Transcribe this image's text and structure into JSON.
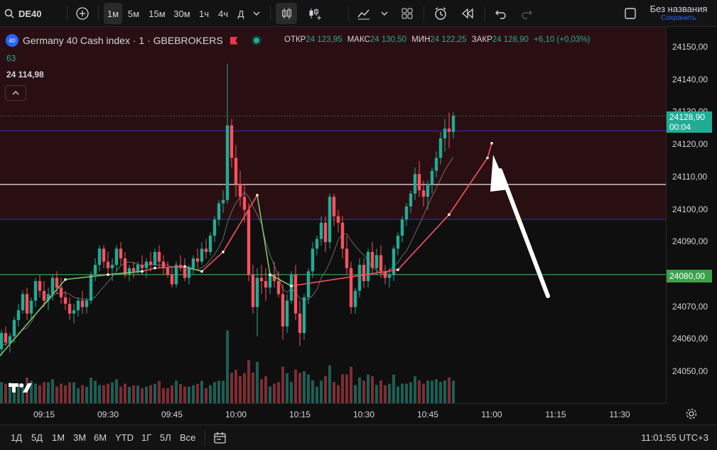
{
  "toolbar": {
    "symbol": "DE40",
    "intervals": [
      "1м",
      "5м",
      "15м",
      "30м",
      "1ч",
      "4ч",
      "Д"
    ],
    "selected_interval": "1м",
    "layout_title": "Без названия",
    "layout_status": "Сохранить"
  },
  "legend": {
    "title": "Germany 40 Cash index · 1 · GBEBROKERS",
    "open_label": "ОТКР",
    "open": "24 123,95",
    "high_label": "МАКС",
    "high": "24 130,50",
    "low_label": "МИН",
    "low": "24 122,25",
    "close_label": "ЗАКР",
    "close": "24 128,90",
    "change": "+6,10 (+0,03%)",
    "indicator_value": "63",
    "indicator_price": "24 114,98"
  },
  "price_axis": {
    "ticks": [
      "24150,00",
      "24140,00",
      "24130,00",
      "24120,00",
      "24110,00",
      "24100,00",
      "24090,00",
      "24080,00",
      "24070,00",
      "24060,00",
      "24050,00"
    ],
    "current_price": "24128,90",
    "countdown": "00:04",
    "level_label": "24080,00"
  },
  "time_axis": {
    "ticks": [
      "09:15",
      "09:30",
      "09:45",
      "10:00",
      "10:15",
      "10:30",
      "10:45",
      "11:00",
      "11:15",
      "11:30"
    ]
  },
  "bottom": {
    "ranges": [
      "1Д",
      "5Д",
      "1М",
      "3М",
      "6М",
      "YTD",
      "1Г",
      "5Л",
      "Все"
    ],
    "clock": "11:01:55 UTC+3"
  },
  "colors": {
    "up": "#22ab94",
    "down": "#f7525f",
    "background": "#0f0f0f",
    "zone": "#2a0f12",
    "blue_line": "#2929c8",
    "green_line": "#3aa14b",
    "white_line": "#e8e8e8"
  },
  "chart_data": {
    "type": "candlestick",
    "symbol": "DE40",
    "interval": "1m",
    "ylim": [
      24043,
      24157
    ],
    "x_range": [
      "09:03",
      "11:39"
    ],
    "horizontal_levels": [
      {
        "price": 24124.3,
        "color": "blue"
      },
      {
        "price": 24107.8,
        "color": "white"
      },
      {
        "price": 24097.0,
        "color": "blue"
      },
      {
        "price": 24080.0,
        "color": "green"
      }
    ],
    "zone": {
      "from": 24097.0,
      "to": 24157.0
    },
    "last_price": 24128.9,
    "zigzag": [
      {
        "time": "09:04",
        "price": 24054,
        "dir": "up"
      },
      {
        "time": "09:20",
        "price": 24078.5,
        "dir": "up"
      },
      {
        "time": "09:30",
        "price": 24080,
        "dir": "up"
      },
      {
        "time": "09:38",
        "price": 24081,
        "dir": "up"
      },
      {
        "time": "09:41",
        "price": 24082,
        "dir": "up"
      },
      {
        "time": "09:48",
        "price": 24082.5,
        "dir": "up"
      },
      {
        "time": "09:52",
        "price": 24081,
        "dir": "down"
      },
      {
        "time": "09:57",
        "price": 24087,
        "dir": "up"
      },
      {
        "time": "10:05",
        "price": 24104.5,
        "dir": "up"
      },
      {
        "time": "10:08",
        "price": 24080,
        "dir": "down"
      },
      {
        "time": "10:13",
        "price": 24076.5,
        "dir": "down"
      },
      {
        "time": "10:38",
        "price": 24081.5,
        "dir": "up"
      },
      {
        "time": "10:50",
        "price": 24098.5,
        "dir": "up"
      },
      {
        "time": "10:59",
        "price": 24116,
        "dir": "up"
      },
      {
        "time": "11:00",
        "price": 24120.5,
        "dir": "up"
      }
    ],
    "candles_note": "1-minute candles from 09:03 to 11:01; values estimated from the price axis",
    "candles": [
      [
        24054,
        24058,
        24052,
        24056
      ],
      [
        24056,
        24059,
        24054,
        24057
      ],
      [
        24057,
        24063,
        24055,
        24062
      ],
      [
        24062,
        24064,
        24058,
        24059
      ],
      [
        24059,
        24062,
        24056,
        24061
      ],
      [
        24061,
        24067,
        24059,
        24066
      ],
      [
        24066,
        24071,
        24064,
        24069
      ],
      [
        24069,
        24075,
        24068,
        24074
      ],
      [
        24074,
        24076,
        24066,
        24068
      ],
      [
        24068,
        24073,
        24066,
        24072
      ],
      [
        24072,
        24079,
        24070,
        24078
      ],
      [
        24078,
        24080,
        24073,
        24075
      ],
      [
        24075,
        24078,
        24070,
        24072
      ],
      [
        24072,
        24076,
        24069,
        24074
      ],
      [
        24074,
        24080,
        24072,
        24079
      ],
      [
        24079,
        24081,
        24074,
        24076
      ],
      [
        24076,
        24079,
        24071,
        24073
      ],
      [
        24073,
        24075,
        24069,
        24071
      ],
      [
        24071,
        24073,
        24066,
        24068
      ],
      [
        24068,
        24071,
        24065,
        24069
      ],
      [
        24069,
        24073,
        24067,
        24072
      ],
      [
        24072,
        24075,
        24068,
        24070
      ],
      [
        24070,
        24073,
        24068,
        24072
      ],
      [
        24072,
        24081,
        24071,
        24080
      ],
      [
        24080,
        24085,
        24078,
        24083
      ],
      [
        24083,
        24089,
        24081,
        24088
      ],
      [
        24088,
        24089,
        24082,
        24084
      ],
      [
        24084,
        24087,
        24080,
        24082
      ],
      [
        24082,
        24085,
        24078,
        24083
      ],
      [
        24083,
        24089,
        24081,
        24088
      ],
      [
        24088,
        24090,
        24083,
        24085
      ],
      [
        24085,
        24087,
        24079,
        24080
      ],
      [
        24080,
        24083,
        24078,
        24082
      ],
      [
        24082,
        24084,
        24079,
        24081
      ],
      [
        24081,
        24084,
        24080,
        24083
      ],
      [
        24083,
        24086,
        24080,
        24082
      ],
      [
        24082,
        24085,
        24079,
        24084
      ],
      [
        24084,
        24087,
        24081,
        24083
      ],
      [
        24083,
        24088,
        24082,
        24087
      ],
      [
        24087,
        24089,
        24082,
        24084
      ],
      [
        24084,
        24086,
        24080,
        24082
      ],
      [
        24082,
        24084,
        24079,
        24080
      ],
      [
        24080,
        24082,
        24076,
        24077
      ],
      [
        24077,
        24084,
        24076,
        24083
      ],
      [
        24083,
        24086,
        24081,
        24082
      ],
      [
        24082,
        24085,
        24078,
        24079
      ],
      [
        24079,
        24083,
        24077,
        24082
      ],
      [
        24082,
        24086,
        24080,
        24085
      ],
      [
        24085,
        24088,
        24082,
        24084
      ],
      [
        24084,
        24090,
        24083,
        24088
      ],
      [
        24088,
        24091,
        24085,
        24087
      ],
      [
        24087,
        24093,
        24086,
        24092
      ],
      [
        24092,
        24098,
        24090,
        24097
      ],
      [
        24097,
        24103,
        24095,
        24102
      ],
      [
        24102,
        24106,
        24099,
        24103
      ],
      [
        24103,
        24145,
        24102,
        24126
      ],
      [
        24126,
        24128,
        24113,
        24116
      ],
      [
        24116,
        24120,
        24104,
        24108
      ],
      [
        24108,
        24112,
        24101,
        24104
      ],
      [
        24104,
        24108,
        24096,
        24100
      ],
      [
        24100,
        24102,
        24078,
        24080
      ],
      [
        24080,
        24083,
        24068,
        24070
      ],
      [
        24070,
        24082,
        24061,
        24079
      ],
      [
        24079,
        24083,
        24074,
        24078
      ],
      [
        24078,
        24082,
        24072,
        24076
      ],
      [
        24076,
        24081,
        24074,
        24080
      ],
      [
        24080,
        24084,
        24076,
        24078
      ],
      [
        24078,
        24081,
        24073,
        24074
      ],
      [
        24074,
        24077,
        24060,
        24064
      ],
      [
        24064,
        24074,
        24062,
        24072
      ],
      [
        24072,
        24081,
        24071,
        24080
      ],
      [
        24080,
        24083,
        24066,
        24068
      ],
      [
        24068,
        24072,
        24058,
        24062
      ],
      [
        24062,
        24074,
        24060,
        24073
      ],
      [
        24073,
        24082,
        24071,
        24081
      ],
      [
        24081,
        24090,
        24079,
        24088
      ],
      [
        24088,
        24092,
        24086,
        24091
      ],
      [
        24091,
        24098,
        24089,
        24096
      ],
      [
        24096,
        24098,
        24087,
        24090
      ],
      [
        24090,
        24105,
        24088,
        24104
      ],
      [
        24104,
        24105,
        24095,
        24098
      ],
      [
        24098,
        24100,
        24093,
        24096
      ],
      [
        24096,
        24098,
        24085,
        24088
      ],
      [
        24088,
        24092,
        24080,
        24082
      ],
      [
        24082,
        24084,
        24068,
        24070
      ],
      [
        24070,
        24076,
        24068,
        24075
      ],
      [
        24075,
        24085,
        24073,
        24083
      ],
      [
        24083,
        24085,
        24076,
        24078
      ],
      [
        24078,
        24088,
        24076,
        24087
      ],
      [
        24087,
        24090,
        24080,
        24082
      ],
      [
        24082,
        24088,
        24080,
        24086
      ],
      [
        24086,
        24089,
        24079,
        24081
      ],
      [
        24081,
        24083,
        24077,
        24079
      ],
      [
        24079,
        24082,
        24076,
        24080
      ],
      [
        24080,
        24089,
        24078,
        24088
      ],
      [
        24088,
        24093,
        24086,
        24092
      ],
      [
        24092,
        24098,
        24090,
        24097
      ],
      [
        24097,
        24102,
        24095,
        24101
      ],
      [
        24101,
        24106,
        24099,
        24105
      ],
      [
        24105,
        24113,
        24103,
        24111
      ],
      [
        24111,
        24115,
        24104,
        24106
      ],
      [
        24106,
        24109,
        24101,
        24104
      ],
      [
        24104,
        24109,
        24100,
        24108
      ],
      [
        24108,
        24113,
        24105,
        24112
      ],
      [
        24112,
        24118,
        24110,
        24116
      ],
      [
        24116,
        24124,
        24114,
        24122
      ],
      [
        24122,
        24128,
        24118,
        24125
      ],
      [
        24125,
        24130,
        24119,
        24124
      ],
      [
        24124,
        24130,
        24122,
        24129
      ]
    ]
  }
}
